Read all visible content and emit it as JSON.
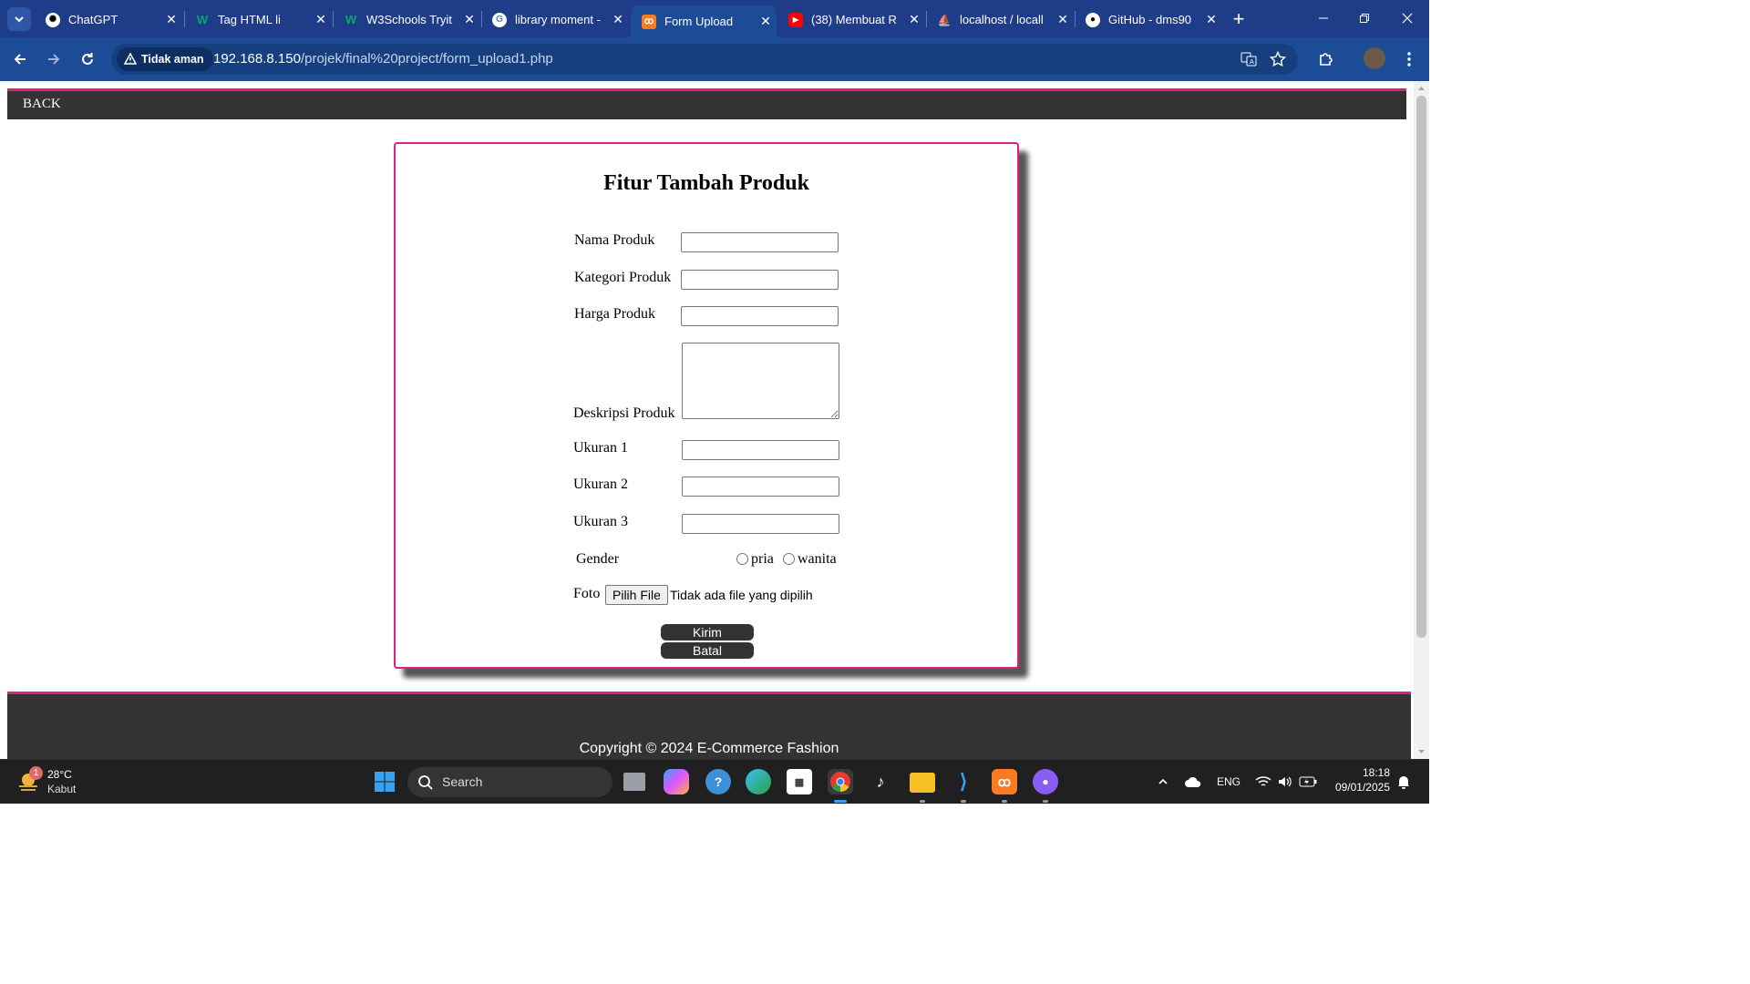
{
  "browser": {
    "tabs": [
      {
        "title": "ChatGPT",
        "icon": "chatgpt-icon"
      },
      {
        "title": "Tag HTML li",
        "icon": "w3schools-icon"
      },
      {
        "title": "W3Schools Tryit",
        "icon": "w3schools-icon"
      },
      {
        "title": "library moment -",
        "icon": "google-icon"
      },
      {
        "title": "Form Upload",
        "icon": "xampp-icon",
        "active": true
      },
      {
        "title": "(38) Membuat R",
        "icon": "youtube-icon"
      },
      {
        "title": "localhost / locall",
        "icon": "phpmyadmin-icon"
      },
      {
        "title": "GitHub - dms90",
        "icon": "github-icon"
      }
    ],
    "security_badge": "Tidak aman",
    "url_host": "192.168.8.150",
    "url_path": "/projek/final%20project/form_upload1.php"
  },
  "page": {
    "nav": {
      "back_label": "BACK"
    },
    "form": {
      "title": "Fitur Tambah Produk",
      "labels": {
        "nama": "Nama Produk",
        "kategori": "Kategori Produk",
        "harga": "Harga Produk",
        "deskripsi": "Deskripsi Produk",
        "ukuran1": "Ukuran 1",
        "ukuran2": "Ukuran 2",
        "ukuran3": "Ukuran 3",
        "gender": "Gender",
        "foto": "Foto"
      },
      "values": {
        "nama": "",
        "kategori": "",
        "harga": "",
        "deskripsi": "",
        "ukuran1": "",
        "ukuran2": "",
        "ukuran3": ""
      },
      "gender_options": [
        "pria",
        "wanita"
      ],
      "file_button": "Pilih File",
      "file_status": "Tidak ada file yang dipilih",
      "submit_label": "Kirim",
      "cancel_label": "Batal"
    },
    "footer": {
      "copyright": "Copyright © 2024 E-Commerce Fashion"
    }
  },
  "taskbar": {
    "weather": {
      "temp": "28°C",
      "condition": "Kabut",
      "badge": "1"
    },
    "search_label": "Search",
    "language": "ENG",
    "time": "18:18",
    "date": "09/01/2025"
  },
  "colors": {
    "accent": "#e0207a",
    "dark": "#333333",
    "tabbar": "#1f3c88",
    "toolbar": "#1c4c96"
  }
}
